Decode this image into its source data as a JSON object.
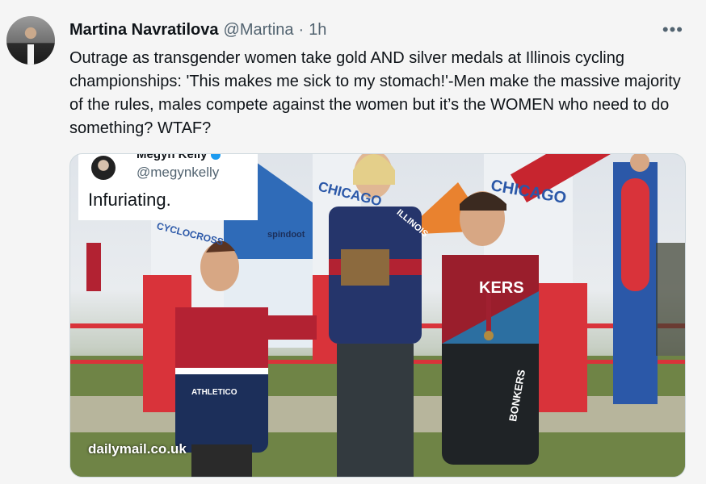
{
  "tweet": {
    "author_name": "Martina Navratilova",
    "author_handle": "@Martina",
    "separator": "·",
    "time": "1h",
    "more_label": "•••",
    "text": "Outrage as transgender women take gold AND silver medals at Illinois cycling championships: 'This makes me sick to my stomach!'-Men make the massive majority of  the rules, males compete against the women but it’s the WOMEN who need to do something? WTAF?"
  },
  "media": {
    "quote": {
      "name": "Megyn Kelly",
      "handle": "@megynkelly",
      "text": "Infuriating."
    },
    "watermark": "dailymail.co.uk",
    "signs": {
      "chicago_left": "CHICAGO",
      "chicago_right": "CHICAGO",
      "cyclocross": "CYCLOCROSS",
      "spindoot": "spindoot",
      "jersey_left": "ATHLETICO",
      "jersey_right": "BONKERS",
      "jersey_right_chest": "KERS",
      "jersey_center": "ILLINOIS"
    }
  },
  "colors": {
    "accent": "#1d9bf0",
    "text": "#0f1419",
    "muted": "#536471",
    "background": "#f5f5f5"
  }
}
